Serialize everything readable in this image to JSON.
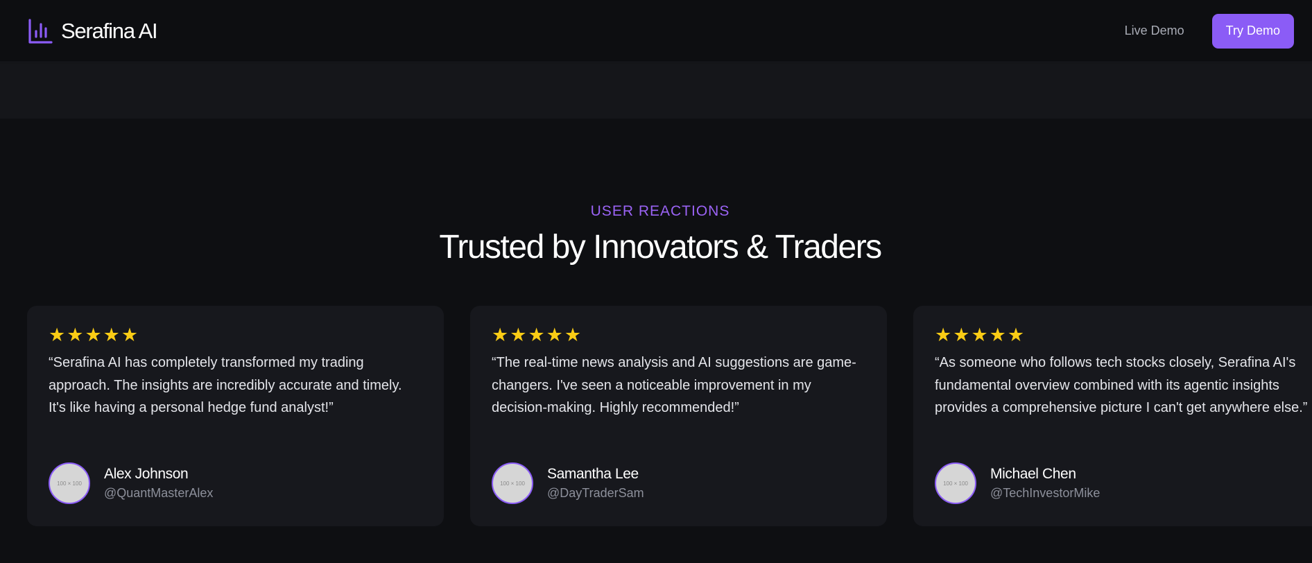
{
  "nav": {
    "brand": "Serafina AI",
    "brand_icon": "bar-chart-icon",
    "live_demo": "Live Demo",
    "try_demo": "Try Demo",
    "accent_color": "#8b5cf6"
  },
  "section": {
    "eyebrow": "USER REACTIONS",
    "title": "Trusted by Innovators & Traders"
  },
  "testimonials": [
    {
      "rating": 5,
      "quote": "“Serafina AI has completely transformed my trading approach. The insights are incredibly accurate and timely. It's like having a personal hedge fund analyst!”",
      "avatar_placeholder": "100 × 100",
      "name": "Alex Johnson",
      "handle": "@QuantMasterAlex"
    },
    {
      "rating": 5,
      "quote": "“The real-time news analysis and AI suggestions are game-changers. I've seen a noticeable improvement in my decision-making. Highly recommended!”",
      "avatar_placeholder": "100 × 100",
      "name": "Samantha Lee",
      "handle": "@DayTraderSam"
    },
    {
      "rating": 5,
      "quote": "“As someone who follows tech stocks closely, Serafina AI's fundamental overview combined with its agentic insights provides a comprehensive picture I can't get anywhere else.”",
      "avatar_placeholder": "100 × 100",
      "name": "Michael Chen",
      "handle": "@TechInvestorMike"
    }
  ]
}
